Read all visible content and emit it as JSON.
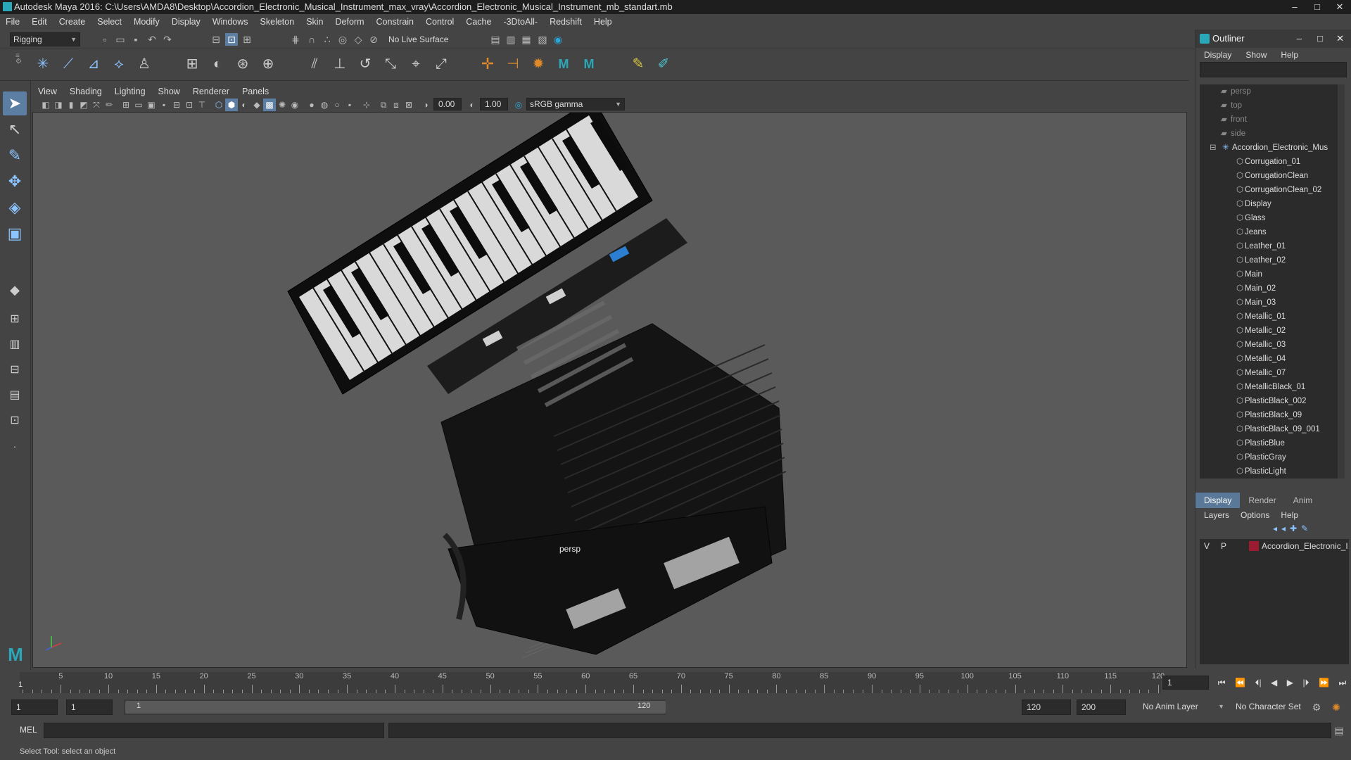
{
  "window": {
    "title": "Autodesk Maya 2016: C:\\Users\\AMDA8\\Desktop\\Accordion_Electronic_Musical_Instrument_max_vray\\Accordion_Electronic_Musical_Instrument_mb_standart.mb",
    "controls": {
      "minimize": "–",
      "maximize": "□",
      "close": "✕"
    }
  },
  "menubar": [
    "File",
    "Edit",
    "Create",
    "Select",
    "Modify",
    "Display",
    "Windows",
    "Skeleton",
    "Skin",
    "Deform",
    "Constrain",
    "Control",
    "Cache",
    "-3DtoAll-",
    "Redshift",
    "Help"
  ],
  "statusline": {
    "mode": "Rigging",
    "live_surface": "No Live Surface"
  },
  "panel_menu": [
    "View",
    "Shading",
    "Lighting",
    "Show",
    "Renderer",
    "Panels"
  ],
  "panel_toolbar": {
    "exposure": "0.00",
    "gamma": "1.00",
    "color_space": "sRGB gamma"
  },
  "viewport": {
    "camera": "persp",
    "background": "#5a5a5a"
  },
  "outliner": {
    "title": "Outliner",
    "controls": {
      "minimize": "–",
      "maximize": "□",
      "close": "✕"
    },
    "menu": [
      "Display",
      "Show",
      "Help"
    ],
    "cameras": [
      "persp",
      "top",
      "front",
      "side"
    ],
    "root": "Accordion_Electronic_Mus",
    "children": [
      "Corrugation_01",
      "CorrugationClean",
      "CorrugationClean_02",
      "Display",
      "Glass",
      "Jeans",
      "Leather_01",
      "Leather_02",
      "Main",
      "Main_02",
      "Main_03",
      "Metallic_01",
      "Metallic_02",
      "Metallic_03",
      "Metallic_04",
      "Metallic_07",
      "MetallicBlack_01",
      "PlasticBlack_002",
      "PlasticBlack_09",
      "PlasticBlack_09_001",
      "PlasticBlue",
      "PlasticGray",
      "PlasticLight"
    ]
  },
  "layer_editor": {
    "tabs": [
      "Display",
      "Render",
      "Anim"
    ],
    "active_tab": "Display",
    "menu": [
      "Layers",
      "Options",
      "Help"
    ],
    "layers": [
      {
        "v": "V",
        "p": "P",
        "name": "Accordion_Electronic_I",
        "color": "#9b1b30"
      }
    ]
  },
  "timeline": {
    "ticks": [
      5,
      10,
      15,
      20,
      25,
      30,
      35,
      40,
      45,
      50,
      55,
      60,
      65,
      70,
      75,
      80,
      85,
      90,
      95,
      100,
      105,
      110,
      115,
      120
    ],
    "start_marker": "1",
    "current_frame": "1",
    "playback_controls": [
      "⏮",
      "⏪",
      "⏴|",
      "◀",
      "▶",
      "|⏵",
      "⏩",
      "⏭"
    ]
  },
  "range": {
    "start_frame": "1",
    "playback_start": "1",
    "slider_start": "1",
    "slider_end": "120",
    "playback_end": "120",
    "end_frame": "200",
    "anim_layer": "No Anim Layer",
    "character_set": "No Character Set"
  },
  "cmdline": {
    "label": "MEL"
  },
  "helpline": {
    "text": "Select Tool: select an object"
  }
}
